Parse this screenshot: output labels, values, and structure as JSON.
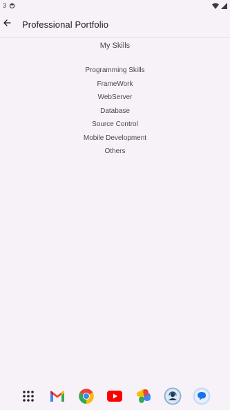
{
  "status_bar": {
    "time_fragment": "3",
    "icons": [
      "notification-icon",
      "wifi-icon",
      "signal-icon"
    ]
  },
  "app_bar": {
    "title": "Professional Portfolio",
    "back_icon": "arrow-back-icon"
  },
  "main": {
    "section_title": "My Skills",
    "skills": [
      "Programming Skills",
      "FrameWork",
      "WebServer",
      "Database",
      "Source Control",
      "Mobile Development",
      "Others"
    ]
  },
  "dock": {
    "apps": [
      "app-drawer",
      "gmail",
      "chrome",
      "youtube",
      "photos",
      "contacts-assistant",
      "messages"
    ]
  },
  "colors": {
    "background": "#F7F2F8",
    "text_primary": "#1D1B20",
    "text_secondary": "#49454F",
    "divider": "#E6E1E8"
  }
}
